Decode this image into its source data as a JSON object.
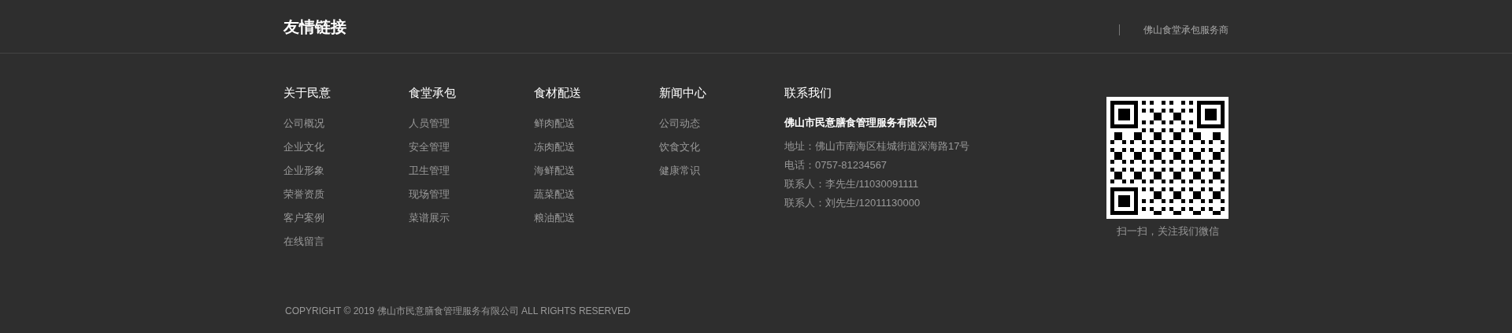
{
  "header": {
    "title": "友情链接",
    "links": [
      "佛山食堂承包服务商"
    ]
  },
  "columns": [
    {
      "heading": "关于民意",
      "links": [
        "公司概况",
        "企业文化",
        "企业形象",
        "荣誉资质",
        "客户案例",
        "在线留言"
      ]
    },
    {
      "heading": "食堂承包",
      "links": [
        "人员管理",
        "安全管理",
        "卫生管理",
        "现场管理",
        "菜谱展示"
      ]
    },
    {
      "heading": "食材配送",
      "links": [
        "鲜肉配送",
        "冻肉配送",
        "海鲜配送",
        "蔬菜配送",
        "粮油配送"
      ]
    },
    {
      "heading": "新闻中心",
      "links": [
        "公司动态",
        "饮食文化",
        "健康常识"
      ]
    }
  ],
  "contact": {
    "heading": "联系我们",
    "company": "佛山市民意膳食管理服务有限公司",
    "lines": [
      "地址：佛山市南海区桂城街道深海路17号",
      "电话：0757-81234567",
      "联系人：李先生/11030091111",
      "联系人：刘先生/12011130000"
    ]
  },
  "qr": {
    "caption": "扫一扫，关注我们微信"
  },
  "copyright": "COPYRIGHT © 2019 佛山市民意膳食管理服务有限公司 ALL RIGHTS RESERVED"
}
